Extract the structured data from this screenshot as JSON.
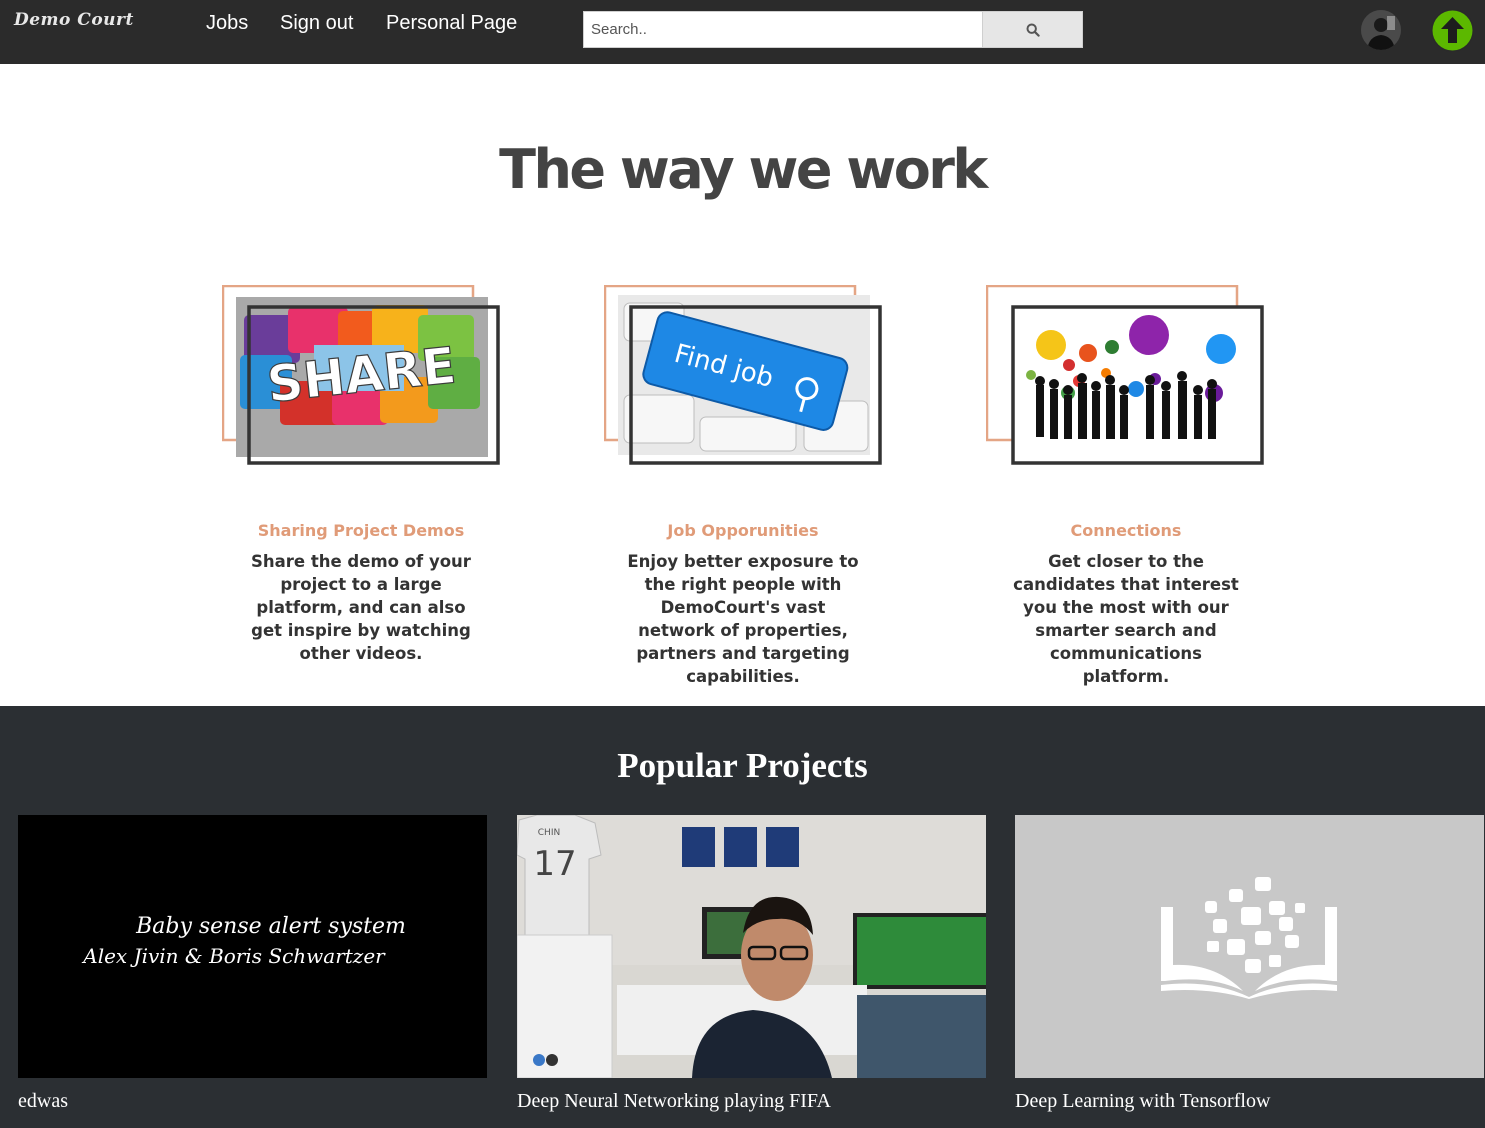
{
  "nav": {
    "logo": "Demo Court",
    "links": [
      "Jobs",
      "Sign out",
      "Personal Page"
    ],
    "search_placeholder": "Search..",
    "accent_up": "#5cb800"
  },
  "intro": {
    "title": "The way we work",
    "cards": [
      {
        "image_text": "SHARE",
        "heading": "Sharing Project Demos",
        "text": "Share the demo of your project to a large platform, and can also get inspire by watching other videos."
      },
      {
        "image_text": "Find job",
        "heading": "Job Opporunities",
        "text": "Enjoy better exposure to the right people with DemoCourt's vast network of properties, partners and targeting capabilities."
      },
      {
        "image_text": "",
        "heading": "Connections",
        "text": "Get closer to the candidates that interest you the most with our smarter search and communications platform."
      }
    ],
    "accent": "#e09b78"
  },
  "popular": {
    "title": "Popular Projects",
    "projects": [
      {
        "title": "edwas",
        "thumb_line1": "Baby sense alert system",
        "thumb_line2": "Alex Jivin & Boris Schwartzer"
      },
      {
        "title": "Deep Neural Networking playing FIFA",
        "jersey_name": "CHIN",
        "jersey_number": "17"
      },
      {
        "title": "Deep Learning with Tensorflow"
      }
    ]
  }
}
